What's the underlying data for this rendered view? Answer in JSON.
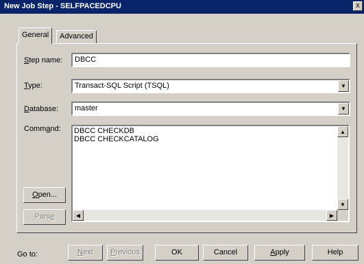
{
  "window": {
    "title": "New Job Step - SELFPACEDCPU",
    "close_glyph": "x"
  },
  "tabs": [
    {
      "label": "General",
      "active": true
    },
    {
      "label": "Advanced",
      "active": false
    }
  ],
  "form": {
    "step_name": {
      "label_key": "S",
      "label_rest": "tep name:",
      "value": "DBCC"
    },
    "type": {
      "label_key": "T",
      "label_rest": "ype:",
      "value": "Transact-SQL Script (TSQL)"
    },
    "database": {
      "label_key": "D",
      "label_rest": "atabase:",
      "value": "master"
    },
    "command": {
      "label_pre": "Comm",
      "label_key": "a",
      "label_rest": "nd:",
      "value": "DBCC CHECKDB\nDBCC CHECKCATALOG"
    }
  },
  "side_buttons": {
    "open": {
      "key": "O",
      "rest": "pen..."
    },
    "parse": {
      "pre": "Pars",
      "key": "e"
    }
  },
  "footer": {
    "goto_label": "Go to:",
    "next": {
      "key": "N",
      "rest": "ext"
    },
    "previous": {
      "key": "P",
      "rest": "revious"
    },
    "ok": "OK",
    "cancel": "Cancel",
    "apply": {
      "key": "A",
      "rest": "pply"
    },
    "help": "Help"
  },
  "icons": {
    "dropdown": "▼",
    "up": "▲",
    "down": "▼",
    "left": "◀",
    "right": "▶"
  }
}
